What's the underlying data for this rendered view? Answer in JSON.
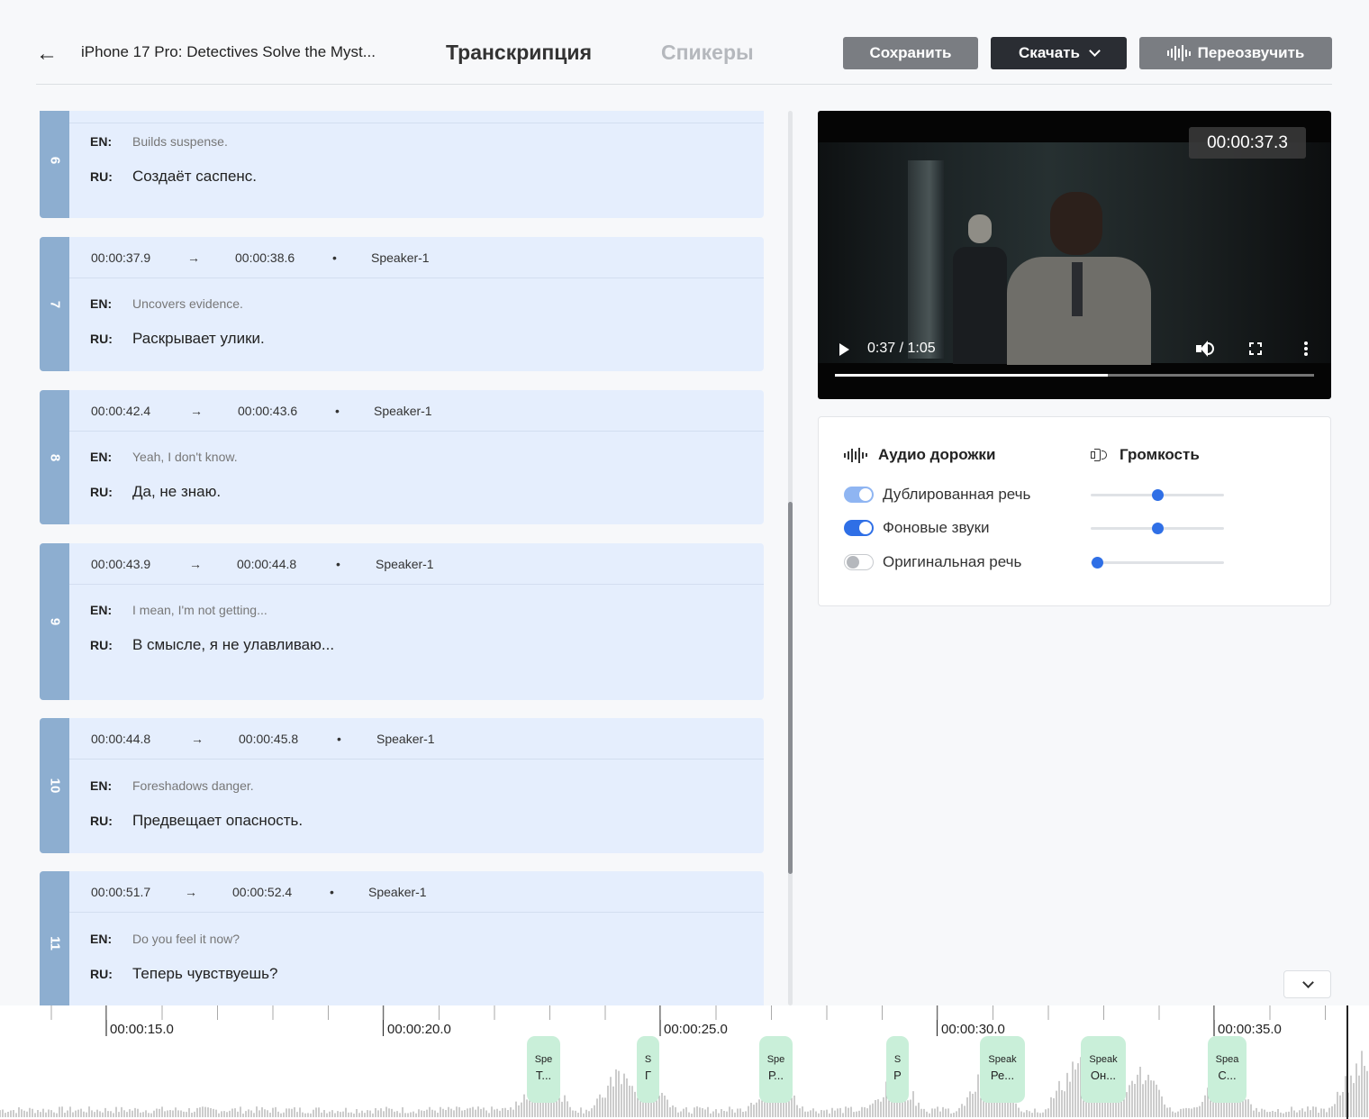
{
  "header": {
    "back_icon": "arrow-left-icon",
    "title": "iPhone 17 Pro: Detectives Solve the Myst...",
    "tabs": [
      {
        "label": "Транскрипция",
        "active": true
      },
      {
        "label": "Спикеры",
        "active": false
      }
    ],
    "buttons": {
      "save": "Сохранить",
      "download": "Скачать",
      "redub": "Переозвучить"
    }
  },
  "segments": [
    {
      "num": "6",
      "start": "",
      "end": "",
      "speaker": "",
      "en": "Builds suspense.",
      "ru": "Создаёт саспенс."
    },
    {
      "num": "7",
      "start": "00:00:37.9",
      "end": "00:00:38.6",
      "speaker": "Speaker-1",
      "en": "Uncovers evidence.",
      "ru": "Раскрывает улики."
    },
    {
      "num": "8",
      "start": "00:00:42.4",
      "end": "00:00:43.6",
      "speaker": "Speaker-1",
      "en": "Yeah, I don't know.",
      "ru": "Да, не знаю."
    },
    {
      "num": "9",
      "start": "00:00:43.9",
      "end": "00:00:44.8",
      "speaker": "Speaker-1",
      "en": "I mean, I'm not getting...",
      "ru": "В смысле, я не улавливаю..."
    },
    {
      "num": "10",
      "start": "00:00:44.8",
      "end": "00:00:45.8",
      "speaker": "Speaker-1",
      "en": "Foreshadows danger.",
      "ru": "Предвещает опасность."
    },
    {
      "num": "11",
      "start": "00:00:51.7",
      "end": "00:00:52.4",
      "speaker": "Speaker-1",
      "en": "Do you feel it now?",
      "ru": "Теперь чувствуешь?"
    }
  ],
  "labels": {
    "en": "EN:",
    "ru": "RU:",
    "arrow": "→",
    "dot": "•"
  },
  "video": {
    "timecode": "00:00:37.3",
    "time_label": "0:37 / 1:05",
    "progress": 0.57
  },
  "audio": {
    "tracks_title": "Аудио дорожки",
    "volume_title": "Громкость",
    "tracks": [
      {
        "name": "Дублированная речь",
        "on": true,
        "dim": true,
        "volume": 0.5
      },
      {
        "name": "Фоновые звуки",
        "on": true,
        "dim": false,
        "volume": 0.5
      },
      {
        "name": "Оригинальная речь",
        "on": false,
        "dim": false,
        "volume": 0.05
      }
    ]
  },
  "colors": {
    "accent": "#2f6fe6",
    "accent_dim": "#8fb5f2",
    "segment_bg": "#e5eefd",
    "segment_num": "#8daed0",
    "chip": "#c9efd9"
  },
  "timeline": {
    "labels": [
      "00:00:15.0",
      "00:00:20.0",
      "00:00:25.0",
      "00:00:30.0",
      "00:00:35.0"
    ],
    "chips": [
      {
        "l1": "Spe",
        "l2": "Т..."
      },
      {
        "l1": "S",
        "l2": "Г"
      },
      {
        "l1": "Spe",
        "l2": "Р..."
      },
      {
        "l1": "S",
        "l2": "Р"
      },
      {
        "l1": "Speak",
        "l2": "Ре..."
      },
      {
        "l1": "Speak",
        "l2": "Он..."
      },
      {
        "l1": "Spea",
        "l2": "С..."
      }
    ]
  }
}
